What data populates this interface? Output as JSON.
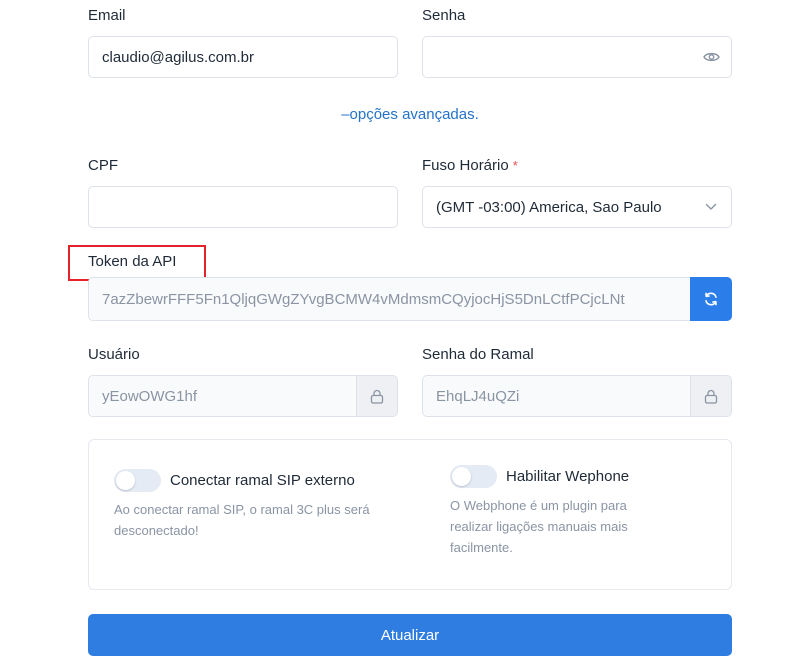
{
  "form": {
    "email": {
      "label": "Email",
      "value": "claudio@agilus.com.br"
    },
    "senha": {
      "label": "Senha",
      "value": ""
    },
    "advanced_link": "–opções avançadas.",
    "cpf": {
      "label": "CPF",
      "value": ""
    },
    "fuso": {
      "label": "Fuso Horário",
      "required_mark": "*",
      "selected": "(GMT -03:00) America, Sao Paulo"
    },
    "token": {
      "label": "Token da API",
      "value": "7azZbewrFFF5Fn1QljqGWgZYvgBCMW4vMdmsmCQyjocHjS5DnLCtfPCjcLNt"
    },
    "usuario": {
      "label": "Usuário",
      "value": "yEowOWG1hf"
    },
    "senha_ramal": {
      "label": "Senha do Ramal",
      "value": "EhqLJ4uQZi"
    },
    "sip_toggle": {
      "title": "Conectar ramal SIP externo",
      "description": "Ao conectar ramal SIP, o ramal 3C plus será desconectado!",
      "enabled": false
    },
    "wephone_toggle": {
      "title": "Habilitar Wephone",
      "description": "O Webphone é um plugin para realizar ligações manuais mais facilmente.",
      "enabled": false
    },
    "submit_label": "Atualizar"
  },
  "colors": {
    "primary": "#2f7de1",
    "link": "#2572c9",
    "highlight": "#e3222a",
    "required": "#e5484d"
  }
}
